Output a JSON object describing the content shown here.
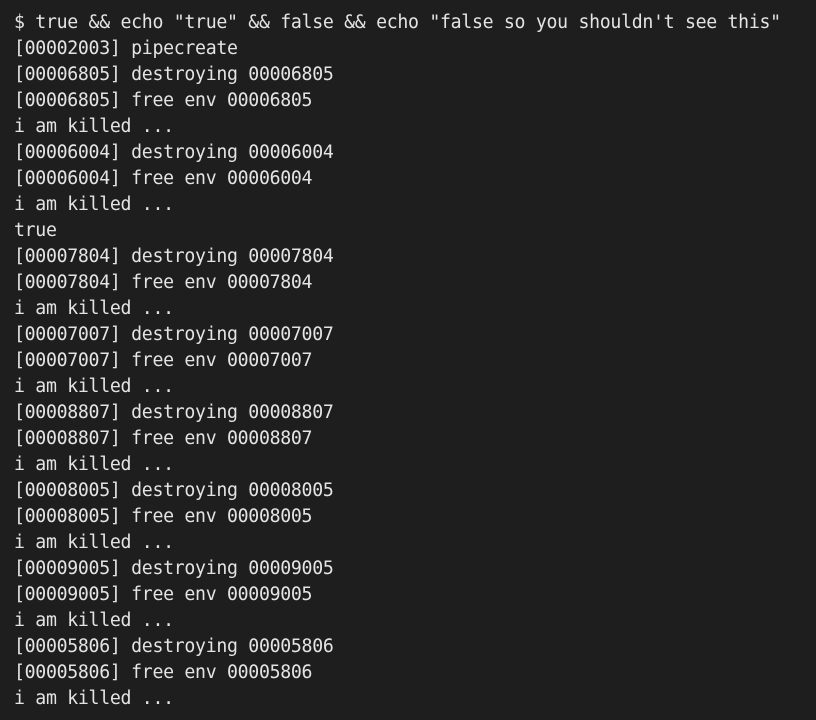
{
  "terminal": {
    "lines": [
      "$ true && echo \"true\" && false && echo \"false so you shouldn't see this\"",
      "[00002003] pipecreate",
      "[00006805] destroying 00006805",
      "[00006805] free env 00006805",
      "i am killed ...",
      "[00006004] destroying 00006004",
      "[00006004] free env 00006004",
      "i am killed ...",
      "true",
      "[00007804] destroying 00007804",
      "[00007804] free env 00007804",
      "i am killed ...",
      "[00007007] destroying 00007007",
      "[00007007] free env 00007007",
      "i am killed ...",
      "[00008807] destroying 00008807",
      "[00008807] free env 00008807",
      "i am killed ...",
      "[00008005] destroying 00008005",
      "[00008005] free env 00008005",
      "i am killed ...",
      "[00009005] destroying 00009005",
      "[00009005] free env 00009005",
      "i am killed ...",
      "[00005806] destroying 00005806",
      "[00005806] free env 00005806",
      "i am killed ..."
    ]
  },
  "colors": {
    "background": "#1e1e1e",
    "foreground": "#e4e4e4"
  }
}
